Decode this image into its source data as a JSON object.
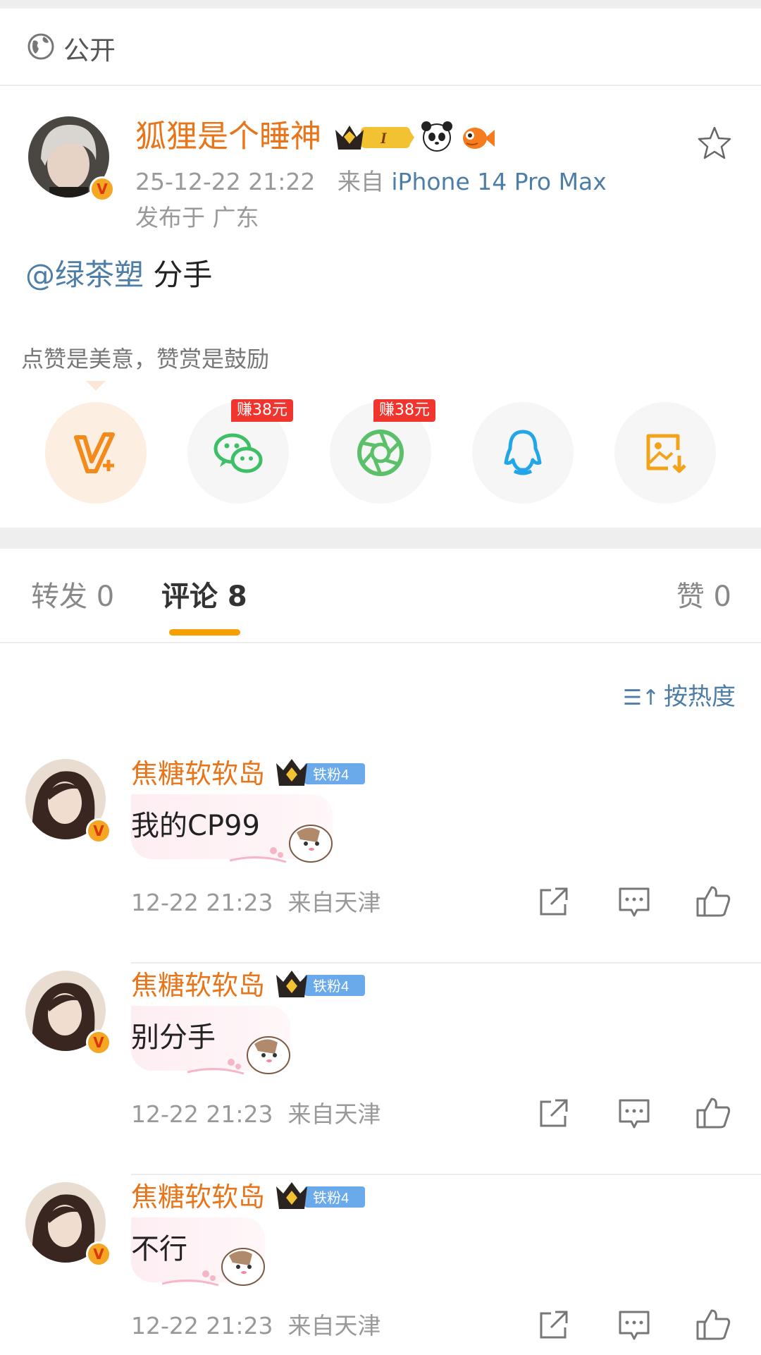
{
  "privacy": {
    "label": "公开",
    "icon": "globe-icon"
  },
  "post": {
    "author": "狐狸是个睡神",
    "badges": [
      {
        "name": "crown-level-badge",
        "text": "I"
      },
      {
        "name": "panda-emoji-badge"
      },
      {
        "name": "fish-emoji-badge"
      }
    ],
    "time": "25-12-22 21:22",
    "from_prefix": "来自",
    "device": "iPhone 14 Pro Max",
    "location": "发布于 广东",
    "mention": "@绿茶塑",
    "text": "分手",
    "slogan": "点赞是美意，赞赏是鼓励"
  },
  "share": {
    "items": [
      {
        "name": "reward-vplus",
        "earn": ""
      },
      {
        "name": "wechat",
        "earn": "赚38元"
      },
      {
        "name": "moments",
        "earn": "赚38元"
      },
      {
        "name": "qq",
        "earn": ""
      },
      {
        "name": "save-image",
        "earn": ""
      }
    ]
  },
  "tabs": {
    "repost": "转发 0",
    "comments": "评论 8",
    "likes": "赞 0"
  },
  "sort": {
    "label": "按热度"
  },
  "comments": [
    {
      "user": "焦糖软软岛",
      "fan_badge": "铁粉4",
      "text": "我的CP99",
      "time": "12-22 21:23",
      "from": "来自天津"
    },
    {
      "user": "焦糖软软岛",
      "fan_badge": "铁粉4",
      "text": "别分手",
      "time": "12-22 21:23",
      "from": "来自天津"
    },
    {
      "user": "焦糖软软岛",
      "fan_badge": "铁粉4",
      "text": "不行",
      "time": "12-22 21:23",
      "from": "来自天津"
    }
  ],
  "colors": {
    "accent": "#f5a000",
    "username": "#e8751a",
    "link": "#4e7ea8",
    "earn_badge": "#f0352e"
  }
}
